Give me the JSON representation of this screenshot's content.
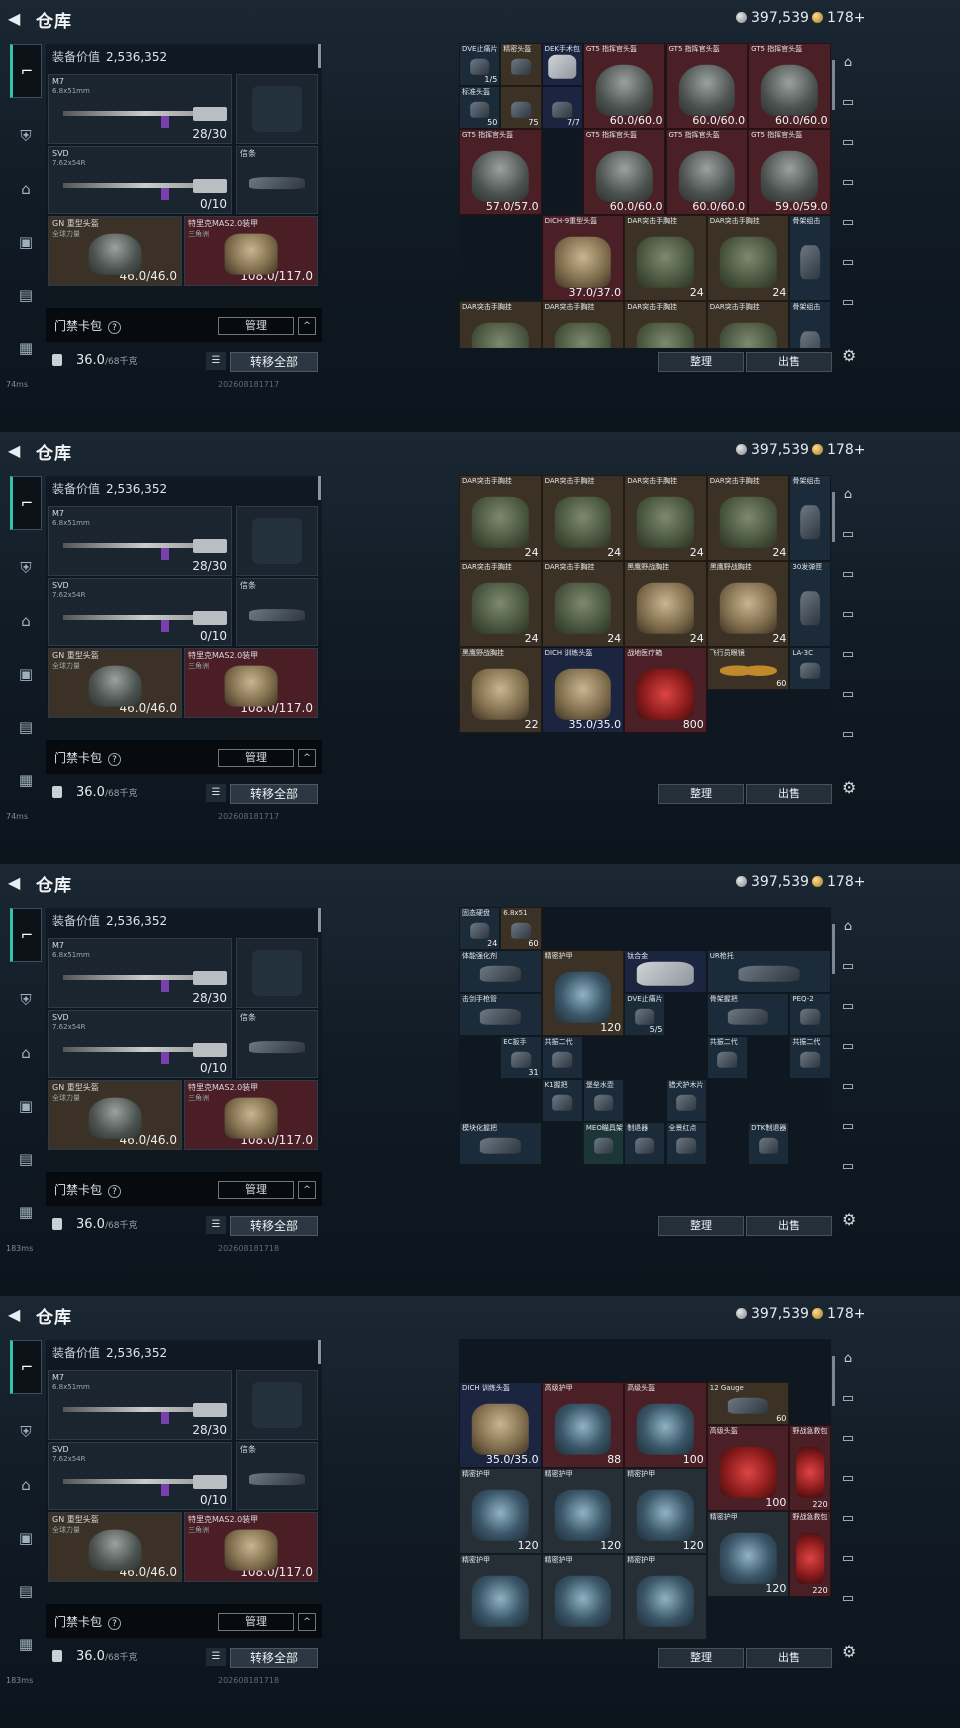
{
  "header": {
    "title": "仓库",
    "back_icon": "back-arrow-icon",
    "silver": "397,539",
    "gold": "178+"
  },
  "categories": [
    "firearm-icon",
    "armor-icon",
    "helmet-icon",
    "backpack-icon",
    "chest-rig-icon",
    "case-icon"
  ],
  "equipment": {
    "value_label": "装备价值",
    "value": "2,536,352",
    "primary": {
      "name": "M7",
      "caliber": "6.8x51mm",
      "ammo": "28/30"
    },
    "secondary": {
      "name": "SVD",
      "caliber": "7.62x54R",
      "ammo": "0/10"
    },
    "melee": {
      "name": "信条"
    },
    "helmet": {
      "name": "GN 重型头盔",
      "sub": "全球力量",
      "durability": "46.0/46.0"
    },
    "armor": {
      "name": "特里克MAS2.0装甲",
      "sub": "三角洲",
      "durability": "108.0/117.0"
    }
  },
  "card_bar": {
    "label": "门禁卡包",
    "help": "?",
    "manage": "管理",
    "collapse": "^"
  },
  "weight_bar": {
    "weight": "36.0",
    "max": "/68千克",
    "transfer": "转移全部"
  },
  "footer": {
    "ping_a": "74ms",
    "ping_b": "183ms",
    "stamp_a": "202608181717",
    "stamp_b": "202608181718"
  },
  "inventory_buttons": {
    "sort": "整理",
    "sell": "出售"
  },
  "frames": [
    {
      "cells": [
        {
          "n": "DVE止痛片",
          "v": "1/5",
          "c": "c-blue",
          "a": "a-part"
        },
        {
          "n": "精密头盔",
          "v": "",
          "c": "c-brown",
          "a": "a-part"
        },
        {
          "n": "DEK手术包",
          "v": "",
          "c": "c-navy",
          "a": "a-case"
        },
        {
          "n": "GT5 指挥官头盔",
          "v": "60.0/60.0",
          "c": "c-red",
          "a": "a-helm",
          "big": 1
        },
        {
          "n": "GT5 指挥官头盔",
          "v": "60.0/60.0",
          "c": "c-red",
          "a": "a-helm",
          "big": 1
        },
        {
          "n": "GT5 指挥官头盔",
          "v": "60.0/60.0",
          "c": "c-red",
          "a": "a-helm",
          "big": 1
        },
        {
          "n": "标准头盔",
          "v": "50",
          "c": "c-blue",
          "a": "a-part"
        },
        {
          "n": "",
          "v": "75",
          "c": "c-brown",
          "a": "a-part"
        },
        {
          "n": "",
          "v": "7/7",
          "c": "c-navy",
          "a": "a-part"
        },
        {
          "n": "GT5 指挥官头盔",
          "v": "60.0/60.0",
          "c": "c-red",
          "a": "a-helm",
          "big": 1
        },
        {
          "n": "GT5 指挥官头盔",
          "v": "60.0/60.0",
          "c": "c-red",
          "a": "a-helm",
          "big": 1
        },
        {
          "n": "GT5 指挥官头盔",
          "v": "59.0/59.0",
          "c": "c-red",
          "a": "a-helm",
          "big": 1
        },
        {
          "n": "GT5 指挥官头盔",
          "v": "57.0/57.0",
          "c": "c-red",
          "a": "a-helm",
          "big": 1
        },
        {
          "n": "DICH-9重型头盔",
          "v": "37.0/37.0",
          "c": "c-red",
          "a": "a-tan",
          "big": 1
        },
        {
          "n": "DAR突击手胸挂",
          "v": "24",
          "c": "c-brown",
          "a": "a-vest",
          "big": 1
        },
        {
          "n": "DAR突击手胸挂",
          "v": "24",
          "c": "c-brown",
          "a": "a-vest",
          "big": 1
        },
        {
          "n": "骨架组击",
          "v": "",
          "c": "c-blue",
          "a": "a-part"
        },
        {
          "n": "DAR突击手胸挂",
          "v": "24",
          "c": "c-brown",
          "a": "a-vest",
          "big": 1
        },
        {
          "n": "DAR突击手胸挂",
          "v": "",
          "c": "c-brown",
          "a": "a-vest",
          "big": 1
        },
        {
          "n": "DAR突击手胸挂",
          "v": "",
          "c": "c-brown",
          "a": "a-vest",
          "big": 1
        },
        {
          "n": "DAR突击手胸挂",
          "v": "",
          "c": "c-brown",
          "a": "a-vest",
          "big": 1
        },
        {
          "n": "骨架组击",
          "v": "",
          "c": "c-blue",
          "a": "a-part"
        }
      ]
    },
    {
      "cells": [
        {
          "n": "DAR突击手胸挂",
          "v": "24",
          "c": "c-brown",
          "a": "a-vest",
          "big": 1
        },
        {
          "n": "DAR突击手胸挂",
          "v": "24",
          "c": "c-brown",
          "a": "a-vest",
          "big": 1
        },
        {
          "n": "DAR突击手胸挂",
          "v": "24",
          "c": "c-brown",
          "a": "a-vest",
          "big": 1
        },
        {
          "n": "DAR突击手胸挂",
          "v": "24",
          "c": "c-brown",
          "a": "a-vest",
          "big": 1
        },
        {
          "n": "骨架组击",
          "v": "",
          "c": "c-blue",
          "a": "a-part"
        },
        {
          "n": "DAR突击手胸挂",
          "v": "24",
          "c": "c-brown",
          "a": "a-vest",
          "big": 1
        },
        {
          "n": "DAR突击手胸挂",
          "v": "24",
          "c": "c-brown",
          "a": "a-vest",
          "big": 1
        },
        {
          "n": "黑鹰野战胸挂",
          "v": "24",
          "c": "c-brown",
          "a": "a-tan",
          "big": 1
        },
        {
          "n": "黑鹰野战胸挂",
          "v": "24",
          "c": "c-brown",
          "a": "a-tan",
          "big": 1
        },
        {
          "n": "30发弹匣",
          "v": "",
          "c": "c-blue",
          "a": "a-part"
        },
        {
          "n": "黑鹰野战胸挂",
          "v": "22",
          "c": "c-brown",
          "a": "a-tan",
          "big": 1
        },
        {
          "n": "DICH 训练头盔",
          "v": "35.0/35.0",
          "c": "c-navy",
          "a": "a-tan",
          "big": 1
        },
        {
          "n": "战地医疗箱",
          "v": "800",
          "c": "c-red",
          "a": "a-med",
          "big": 1
        },
        {
          "n": "飞行员眼镜",
          "v": "60",
          "c": "c-brown",
          "a": "a-glass"
        },
        {
          "n": "LA-3C",
          "v": "",
          "c": "c-blue",
          "a": "a-part"
        }
      ]
    },
    {
      "cells": [
        {
          "n": "固态硬盘",
          "v": "24",
          "c": "c-blue",
          "a": "a-part"
        },
        {
          "n": "6.8x51",
          "v": "60",
          "c": "c-brown",
          "a": "a-part"
        },
        {
          "n": "体能强化剂",
          "v": "",
          "c": "c-blue",
          "a": "a-part"
        },
        {
          "n": "精密护甲",
          "v": "120",
          "c": "c-brown",
          "a": "a-bag",
          "big": 1
        },
        {
          "n": "钛合金",
          "v": "",
          "c": "c-navy",
          "a": "a-case"
        },
        {
          "n": "UR枪托",
          "v": "",
          "c": "c-blue",
          "a": "a-part"
        },
        {
          "n": "击剑手枪管",
          "v": "",
          "c": "c-blue",
          "a": "a-part"
        },
        {
          "n": "DVE止痛片",
          "v": "5/5",
          "c": "c-blue",
          "a": "a-part"
        },
        {
          "n": "骨架握把",
          "v": "",
          "c": "c-blue",
          "a": "a-part"
        },
        {
          "n": "PEQ-2",
          "v": "",
          "c": "c-blue",
          "a": "a-part"
        },
        {
          "n": "EC扳手",
          "v": "31",
          "c": "c-blue",
          "a": "a-part"
        },
        {
          "n": "共振二代",
          "v": "",
          "c": "c-blue",
          "a": "a-part"
        },
        {
          "n": "共振二代",
          "v": "",
          "c": "c-blue",
          "a": "a-part"
        },
        {
          "n": "共振二代",
          "v": "",
          "c": "c-blue",
          "a": "a-part"
        },
        {
          "n": "K1握把",
          "v": "",
          "c": "c-blue",
          "a": "a-part"
        },
        {
          "n": "堡垒水壶",
          "v": "",
          "c": "c-blue",
          "a": "a-part"
        },
        {
          "n": "猎犬护木片",
          "v": "",
          "c": "c-blue",
          "a": "a-part"
        },
        {
          "n": "模块化握把",
          "v": "",
          "c": "c-blue",
          "a": "a-part"
        },
        {
          "n": "MEO瞄具架",
          "v": "",
          "c": "c-teal",
          "a": "a-part"
        },
        {
          "n": "制退器",
          "v": "",
          "c": "c-blue",
          "a": "a-part"
        },
        {
          "n": "全景红点",
          "v": "",
          "c": "c-blue",
          "a": "a-part"
        },
        {
          "n": "DTK制退器",
          "v": "",
          "c": "c-blue",
          "a": "a-part"
        }
      ]
    },
    {
      "cells": [
        {
          "n": "DICH 训练头盔",
          "v": "35.0/35.0",
          "c": "c-navy",
          "a": "a-tan",
          "big": 1
        },
        {
          "n": "高级护甲",
          "v": "88",
          "c": "c-red",
          "a": "a-bag",
          "big": 1
        },
        {
          "n": "高级头盔",
          "v": "100",
          "c": "c-red",
          "a": "a-bag",
          "big": 1
        },
        {
          "n": "12 Gauge",
          "v": "60",
          "c": "c-brown",
          "a": "a-part"
        },
        {
          "n": "高级头盔",
          "v": "100",
          "c": "c-red",
          "a": "a-med",
          "big": 1
        },
        {
          "n": "野战急救包",
          "v": "220",
          "c": "c-red",
          "a": "a-med"
        },
        {
          "n": "精密护甲",
          "v": "120",
          "c": "c-gray",
          "a": "a-bag",
          "big": 1
        },
        {
          "n": "精密护甲",
          "v": "120",
          "c": "c-gray",
          "a": "a-bag",
          "big": 1
        },
        {
          "n": "精密护甲",
          "v": "120",
          "c": "c-gray",
          "a": "a-bag",
          "big": 1
        },
        {
          "n": "精密护甲",
          "v": "120",
          "c": "c-gray",
          "a": "a-bag",
          "big": 1
        },
        {
          "n": "野战急救包",
          "v": "220",
          "c": "c-red",
          "a": "a-med"
        },
        {
          "n": "精密护甲",
          "v": "",
          "c": "c-gray",
          "a": "a-bag",
          "big": 1
        },
        {
          "n": "精密护甲",
          "v": "",
          "c": "c-gray",
          "a": "a-bag",
          "big": 1
        },
        {
          "n": "精密护甲",
          "v": "",
          "c": "c-gray",
          "a": "a-bag",
          "big": 1
        }
      ]
    }
  ]
}
